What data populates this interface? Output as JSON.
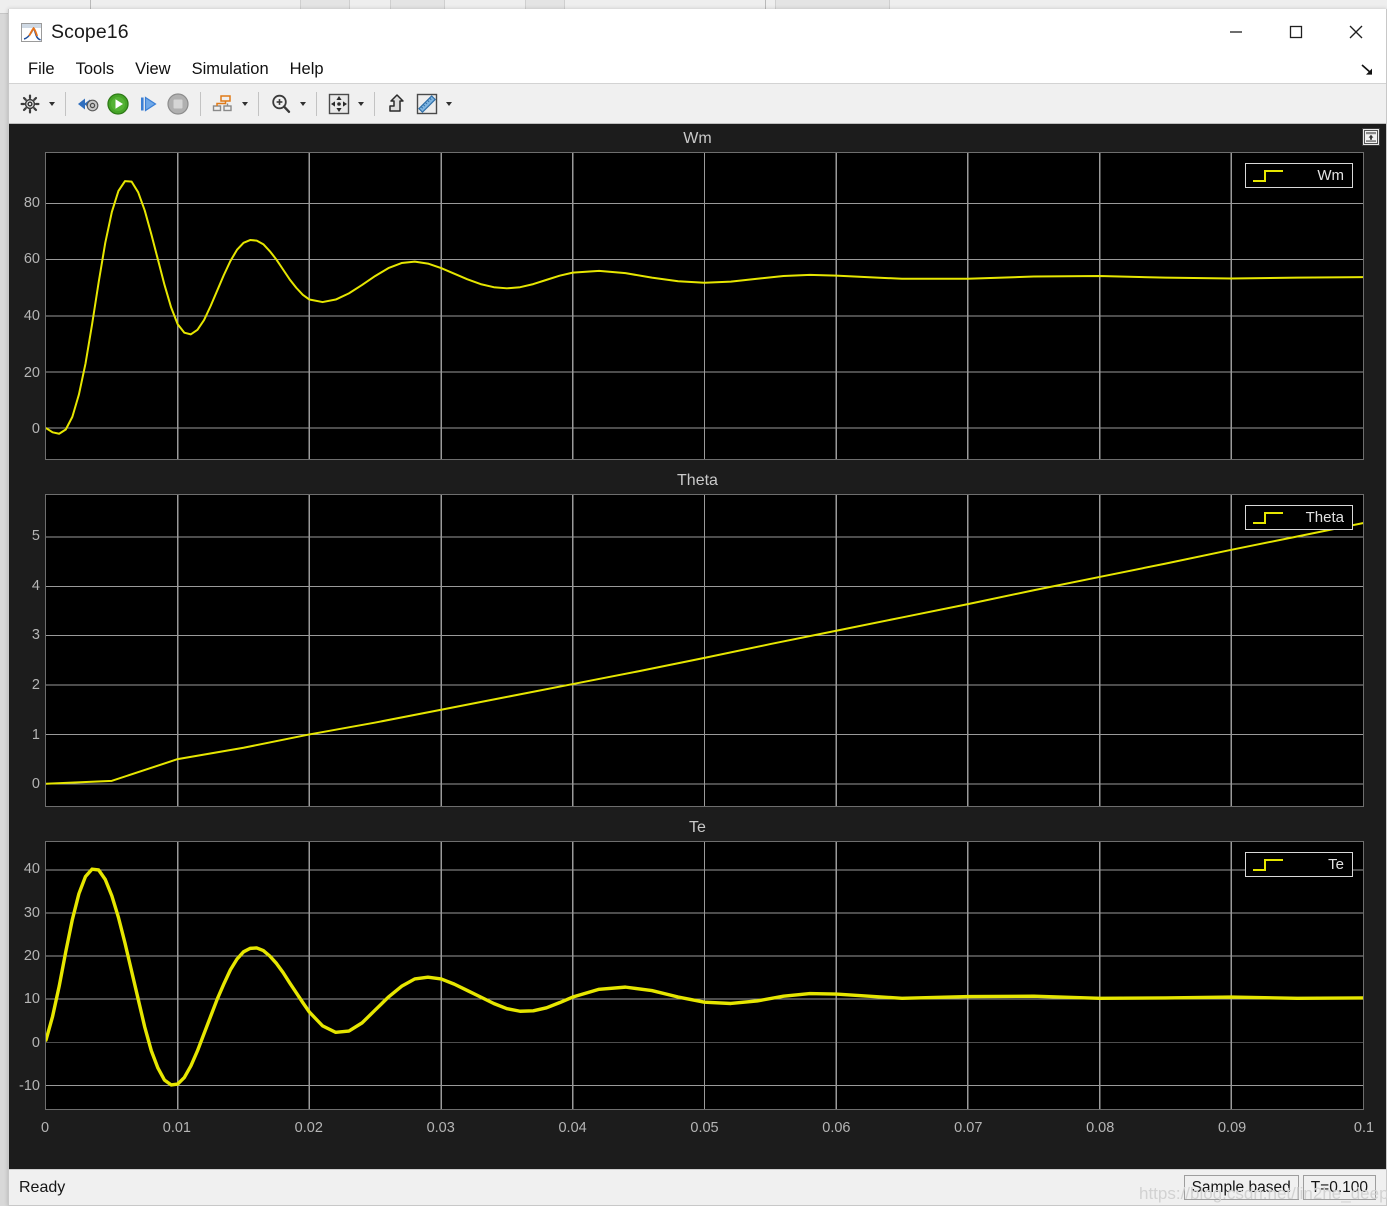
{
  "window": {
    "title": "Scope16",
    "app_icon": "matlab-icon",
    "minimize_label": "Minimize",
    "maximize_label": "Maximize",
    "close_label": "Close"
  },
  "menu": {
    "items": [
      {
        "label": "File",
        "name": "menu-file"
      },
      {
        "label": "Tools",
        "name": "menu-tools"
      },
      {
        "label": "View",
        "name": "menu-view"
      },
      {
        "label": "Simulation",
        "name": "menu-simulation"
      },
      {
        "label": "Help",
        "name": "menu-help"
      }
    ],
    "dock_icon": "undock-arrow-icon"
  },
  "toolbar": {
    "buttons": [
      {
        "name": "configuration-properties-button",
        "icon": "gear-icon",
        "caret": true
      },
      {
        "name": "step-back-button",
        "icon": "rewind-gear-icon",
        "caret": false
      },
      {
        "name": "run-button",
        "icon": "play-icon",
        "caret": false
      },
      {
        "name": "step-forward-button",
        "icon": "step-forward-icon",
        "caret": false
      },
      {
        "name": "stop-button",
        "icon": "stop-icon",
        "caret": false
      },
      {
        "name": "layout-button",
        "icon": "signal-layout-icon",
        "caret": true
      },
      {
        "name": "zoom-button",
        "icon": "zoom-in-icon",
        "caret": true
      },
      {
        "name": "autoscale-button",
        "icon": "fit-to-view-icon",
        "caret": true
      },
      {
        "name": "highlight-signal-button",
        "icon": "highlight-signal-icon",
        "caret": false
      },
      {
        "name": "cursor-measurements-button",
        "icon": "ruler-icon",
        "caret": true
      }
    ]
  },
  "scope": {
    "panel_restore_icon": "panel-restore-icon",
    "shared_x_axis": {
      "ticks": [
        "0",
        "0.01",
        "0.02",
        "0.03",
        "0.04",
        "0.05",
        "0.06",
        "0.07",
        "0.08",
        "0.09",
        "0.1"
      ]
    }
  },
  "status": {
    "ready": "Ready",
    "sample_mode": "Sample based",
    "time": "T=0.100",
    "watermark": "https://blog.csdn.net/lin2he_deep"
  },
  "colors": {
    "trace": "#e6e600",
    "plot_background": "#000000",
    "panel_background": "#1c1c1c",
    "grid": "#9a9a9a",
    "axis_text": "#b5b5b5"
  },
  "chart_data": [
    {
      "type": "line",
      "title": "Wm",
      "xlabel": "",
      "ylabel": "",
      "xlim": [
        0,
        0.1
      ],
      "ylim": [
        -11,
        98
      ],
      "xticks": [
        0,
        0.01,
        0.02,
        0.03,
        0.04,
        0.05,
        0.06,
        0.07,
        0.08,
        0.09,
        0.1
      ],
      "ytick_labels": [
        "0",
        "20",
        "40",
        "60",
        "80"
      ],
      "yticks": [
        0,
        20,
        40,
        60,
        80
      ],
      "grid": true,
      "legend": {
        "position": "top-right",
        "entries": [
          "Wm"
        ]
      },
      "series": [
        {
          "name": "Wm",
          "color": "#e6e600",
          "x": [
            0,
            0.0005,
            0.001,
            0.0015,
            0.002,
            0.0025,
            0.003,
            0.0035,
            0.004,
            0.0045,
            0.005,
            0.0055,
            0.006,
            0.0065,
            0.007,
            0.0075,
            0.008,
            0.0085,
            0.009,
            0.0095,
            0.01,
            0.0105,
            0.011,
            0.0115,
            0.012,
            0.0125,
            0.013,
            0.0135,
            0.014,
            0.0145,
            0.015,
            0.0155,
            0.016,
            0.0165,
            0.017,
            0.0175,
            0.018,
            0.0185,
            0.019,
            0.0195,
            0.02,
            0.021,
            0.022,
            0.023,
            0.024,
            0.025,
            0.026,
            0.027,
            0.028,
            0.029,
            0.03,
            0.031,
            0.032,
            0.033,
            0.034,
            0.035,
            0.036,
            0.037,
            0.038,
            0.039,
            0.04,
            0.042,
            0.044,
            0.046,
            0.048,
            0.05,
            0.052,
            0.054,
            0.056,
            0.058,
            0.06,
            0.065,
            0.07,
            0.075,
            0.08,
            0.085,
            0.09,
            0.095,
            0.1
          ],
          "y": [
            0,
            -1.5,
            -2.0,
            -0.5,
            4.0,
            12.0,
            23.0,
            37.0,
            52.0,
            66.0,
            77.0,
            84.5,
            88.0,
            87.8,
            84.0,
            77.5,
            69.0,
            60.0,
            51.0,
            43.0,
            37.0,
            34.0,
            33.4,
            35.0,
            38.5,
            43.5,
            49.0,
            54.5,
            59.5,
            63.5,
            66.0,
            67.0,
            66.8,
            65.5,
            63.0,
            60.0,
            56.5,
            53.0,
            50.0,
            47.5,
            45.8,
            44.9,
            45.8,
            48.0,
            51.0,
            54.2,
            57.0,
            58.8,
            59.3,
            58.6,
            57.0,
            55.0,
            53.0,
            51.3,
            50.2,
            49.8,
            50.2,
            51.3,
            52.8,
            54.3,
            55.4,
            56.0,
            55.2,
            53.6,
            52.3,
            51.8,
            52.2,
            53.2,
            54.2,
            54.6,
            54.3,
            53.2,
            53.2,
            54.0,
            54.2,
            53.6,
            53.3,
            53.6,
            53.8
          ]
        }
      ]
    },
    {
      "type": "line",
      "title": "Theta",
      "xlabel": "",
      "ylabel": "",
      "xlim": [
        0,
        0.1
      ],
      "ylim": [
        -0.45,
        5.85
      ],
      "xticks": [
        0,
        0.01,
        0.02,
        0.03,
        0.04,
        0.05,
        0.06,
        0.07,
        0.08,
        0.09,
        0.1
      ],
      "ytick_labels": [
        "0",
        "1",
        "2",
        "3",
        "4",
        "5"
      ],
      "yticks": [
        0,
        1,
        2,
        3,
        4,
        5
      ],
      "grid": true,
      "legend": {
        "position": "top-right",
        "entries": [
          "Theta"
        ]
      },
      "series": [
        {
          "name": "Theta",
          "color": "#e6e600",
          "x": [
            0,
            0.005,
            0.01,
            0.015,
            0.02,
            0.025,
            0.03,
            0.035,
            0.04,
            0.045,
            0.05,
            0.055,
            0.06,
            0.065,
            0.07,
            0.075,
            0.08,
            0.085,
            0.09,
            0.095,
            0.1
          ],
          "y": [
            0.0,
            0.06,
            0.5,
            0.73,
            1.0,
            1.24,
            1.5,
            1.76,
            2.02,
            2.28,
            2.55,
            2.83,
            3.1,
            3.37,
            3.64,
            3.92,
            4.19,
            4.46,
            4.74,
            5.01,
            5.28
          ]
        }
      ]
    },
    {
      "type": "line",
      "title": "Te",
      "xlabel": "",
      "ylabel": "",
      "xlim": [
        0,
        0.1
      ],
      "ylim": [
        -15.5,
        46.5
      ],
      "xticks": [
        0,
        0.01,
        0.02,
        0.03,
        0.04,
        0.05,
        0.06,
        0.07,
        0.08,
        0.09,
        0.1
      ],
      "ytick_labels": [
        "-10",
        "0",
        "10",
        "20",
        "30",
        "40"
      ],
      "yticks": [
        -10,
        0,
        10,
        20,
        30,
        40
      ],
      "grid": true,
      "legend": {
        "position": "top-right",
        "entries": [
          "Te"
        ]
      },
      "series": [
        {
          "name": "Te",
          "color": "#e6e600",
          "x": [
            0,
            0.0005,
            0.001,
            0.0015,
            0.002,
            0.0025,
            0.003,
            0.0035,
            0.004,
            0.0045,
            0.005,
            0.0055,
            0.006,
            0.0065,
            0.007,
            0.0075,
            0.008,
            0.0085,
            0.009,
            0.0095,
            0.01,
            0.0105,
            0.011,
            0.0115,
            0.012,
            0.0125,
            0.013,
            0.0135,
            0.014,
            0.0145,
            0.015,
            0.0155,
            0.016,
            0.0165,
            0.017,
            0.0175,
            0.018,
            0.0185,
            0.019,
            0.0195,
            0.02,
            0.021,
            0.022,
            0.023,
            0.024,
            0.025,
            0.026,
            0.027,
            0.028,
            0.029,
            0.03,
            0.031,
            0.032,
            0.033,
            0.034,
            0.035,
            0.036,
            0.037,
            0.038,
            0.039,
            0.04,
            0.042,
            0.044,
            0.046,
            0.048,
            0.05,
            0.052,
            0.054,
            0.056,
            0.058,
            0.06,
            0.065,
            0.07,
            0.075,
            0.08,
            0.085,
            0.09,
            0.095,
            0.1
          ],
          "y": [
            0.5,
            6.0,
            13.0,
            21.0,
            28.5,
            34.5,
            38.5,
            40.2,
            40.0,
            37.8,
            34.0,
            29.0,
            23.0,
            16.5,
            10.0,
            3.5,
            -2.0,
            -6.0,
            -8.8,
            -9.9,
            -9.7,
            -8.2,
            -5.5,
            -2.0,
            2.0,
            6.0,
            10.0,
            13.5,
            16.8,
            19.3,
            21.0,
            21.8,
            21.9,
            21.3,
            20.0,
            18.3,
            16.2,
            13.8,
            11.5,
            9.2,
            7.0,
            3.8,
            2.3,
            2.6,
            4.5,
            7.5,
            10.5,
            13.0,
            14.7,
            15.1,
            14.7,
            13.5,
            12.0,
            10.5,
            9.0,
            7.8,
            7.2,
            7.3,
            8.0,
            9.2,
            10.5,
            12.3,
            12.8,
            12.0,
            10.5,
            9.3,
            9.0,
            9.6,
            10.7,
            11.3,
            11.2,
            10.2,
            10.6,
            10.7,
            10.2,
            10.3,
            10.5,
            10.2,
            10.3
          ]
        }
      ]
    }
  ]
}
